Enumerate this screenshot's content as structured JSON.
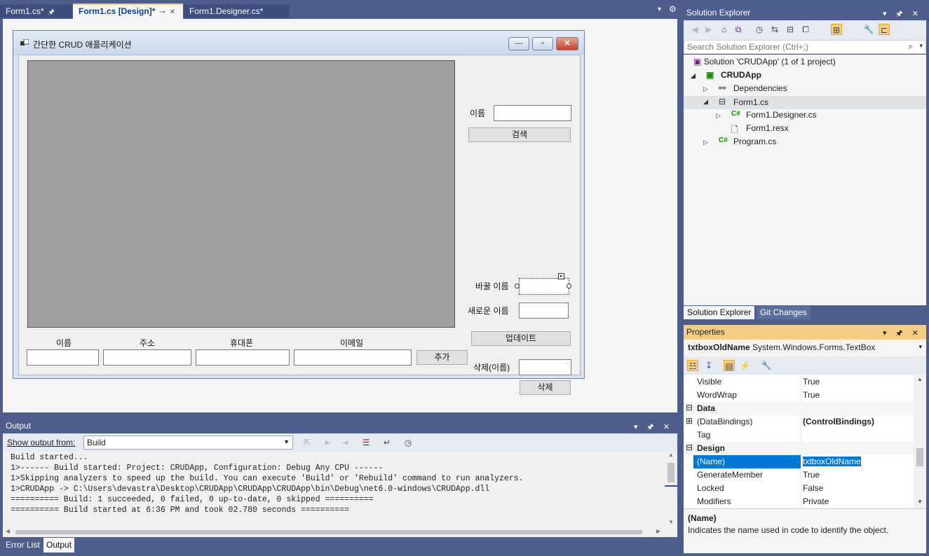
{
  "doc_tabs": [
    {
      "label": "Form1.cs*"
    },
    {
      "label": "Form1.cs [Design]*"
    },
    {
      "label": "Form1.Designer.cs*"
    }
  ],
  "form": {
    "title": "간단한 CRUD 애플리케이션",
    "search_name_label": "이름",
    "search_button": "검색",
    "old_name_label": "바꿀 이름",
    "new_name_label": "새로운 이름",
    "update_button": "업데이트",
    "delete_label": "삭제(이름)",
    "delete_button": "삭제",
    "col_name": "이름",
    "col_address": "주소",
    "col_phone": "휴대폰",
    "col_email": "이메일",
    "add_button": "추가"
  },
  "output": {
    "title": "Output",
    "show_from_label": "Show output from:",
    "show_from_value": "Build",
    "lines": [
      "Build started...",
      "1>------ Build started: Project: CRUDApp, Configuration: Debug Any CPU ------",
      "1>Skipping analyzers to speed up the build. You can execute 'Build' or 'Rebuild' command to run analyzers.",
      "1>CRUDApp -> C:\\Users\\devastra\\Desktop\\CRUDApp\\CRUDApp\\CRUDApp\\bin\\Debug\\net6.0-windows\\CRUDApp.dll",
      "========== Build: 1 succeeded, 0 failed, 0 up-to-date, 0 skipped ==========",
      "========== Build started at 6:36 PM and took 02.780 seconds =========="
    ]
  },
  "bottom_tabs": [
    "Error List",
    "Output"
  ],
  "solution_explorer": {
    "title": "Solution Explorer",
    "search_placeholder": "Search Solution Explorer (Ctrl+;)",
    "tree": [
      {
        "label": "Solution 'CRUDApp'   (1 of 1 project)"
      },
      {
        "label": "CRUDApp"
      },
      {
        "label": "Dependencies"
      },
      {
        "label": "Form1.cs"
      },
      {
        "label": "Form1.Designer.cs"
      },
      {
        "label": "Form1.resx"
      },
      {
        "label": "Program.cs"
      }
    ],
    "tabs": [
      "Solution Explorer",
      "Git Changes"
    ]
  },
  "properties": {
    "title": "Properties",
    "object_name": "txtboxOldName",
    "object_type": "System.Windows.Forms.TextBox",
    "rows": [
      {
        "name": "Visible",
        "value": "True"
      },
      {
        "name": "WordWrap",
        "value": "True"
      },
      {
        "name": "Data",
        "value": ""
      },
      {
        "name": "(DataBindings)",
        "value": "(ControlBindings)"
      },
      {
        "name": "Tag",
        "value": ""
      },
      {
        "name": "Design",
        "value": ""
      },
      {
        "name": "(Name)",
        "value": "txtboxOldName"
      },
      {
        "name": "GenerateMember",
        "value": "True"
      },
      {
        "name": "Locked",
        "value": "False"
      },
      {
        "name": "Modifiers",
        "value": "Private"
      }
    ],
    "desc_title": "(Name)",
    "desc_text": "Indicates the name used in code to identify the object."
  },
  "colors": {
    "accent": "#0078d7",
    "chrome": "#4e5e8c",
    "highlight": "#f5cc84"
  }
}
